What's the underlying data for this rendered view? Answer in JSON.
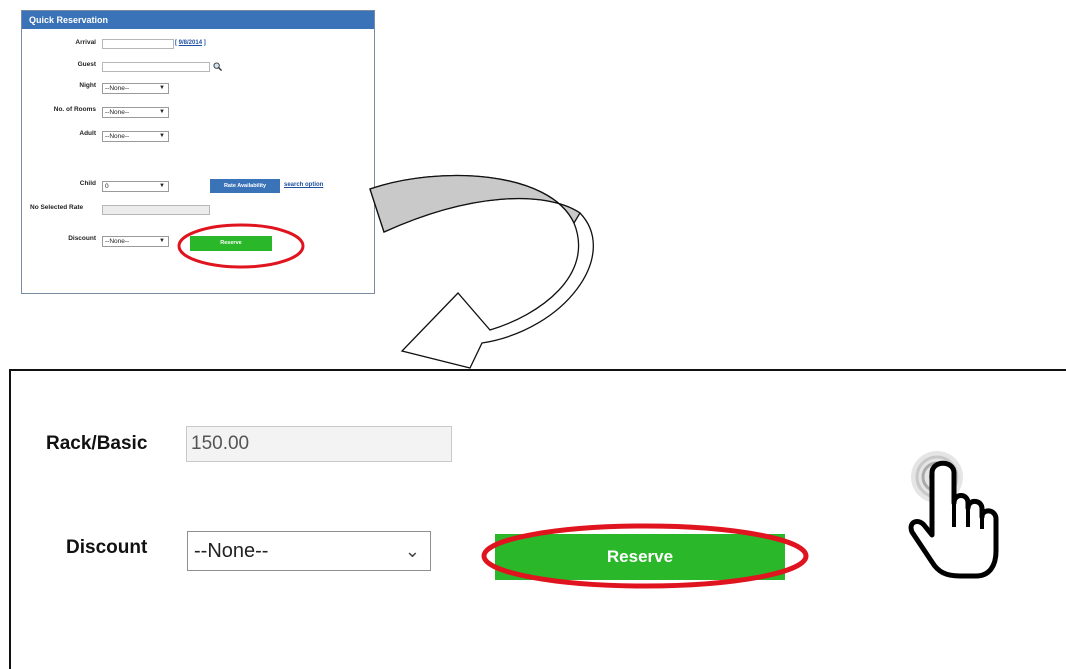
{
  "mini_panel": {
    "title": "Quick Reservation",
    "fields": {
      "arrival_label": "Arrival",
      "arrival_date_link": "9/8/2014",
      "guest_label": "Guest",
      "night_label": "Night",
      "night_value": "--None--",
      "rooms_label": "No. of Rooms",
      "rooms_value": "--None--",
      "adult_label": "Adult",
      "adult_value": "--None--",
      "child_label": "Child",
      "child_value": "0",
      "rate_button": "Rate Availability",
      "search_link": "search option",
      "no_rate_label": "No Selected Rate",
      "discount_label": "Discount",
      "discount_value": "--None--",
      "reserve_button": "Reserve"
    }
  },
  "zoom_panel": {
    "rack_label": "Rack/Basic",
    "rack_value": "150.00",
    "discount_label": "Discount",
    "discount_value": "--None--",
    "reserve_button": "Reserve"
  },
  "colors": {
    "header_blue": "#3b73b9",
    "button_green": "#2ab82a",
    "highlight_red": "#e0141e"
  },
  "icons": {
    "guest_search": "magnifier-icon",
    "pointer": "hand-pointer-icon",
    "flow_arrow": "curved-arrow-icon"
  }
}
